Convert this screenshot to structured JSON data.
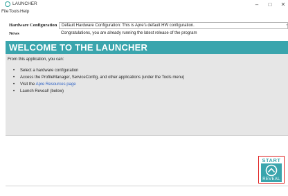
{
  "window": {
    "title": "LAUNCHER",
    "minimize": "–",
    "maximize": "□",
    "close": "✕"
  },
  "menu": [
    "File",
    "Tools",
    "Help"
  ],
  "hardware": {
    "label": "Hardware Configuration",
    "selected": "Default Hardware Configuration: This is Apre's default HW configuration."
  },
  "news": {
    "label": "News",
    "text": "Congratulations, you are already running the latest release of the program"
  },
  "banner": {
    "title": "WELCOME TO THE LAUNCHER"
  },
  "content": {
    "intro": "From this application, you can:",
    "bullets": [
      "Select a hardware configuration",
      "Access the ProfileManager, ServiceConfig, and other applications (under the Tools menu)",
      "Visit the",
      "Launch Reveal! (below)"
    ],
    "link_text": "Apre Resources page"
  },
  "launch": {
    "start_label": "START",
    "reveal_label": "REVEAL"
  },
  "colors": {
    "accent": "#3aa5ad",
    "highlight_border": "#e02020",
    "link": "#2a5fc4"
  }
}
